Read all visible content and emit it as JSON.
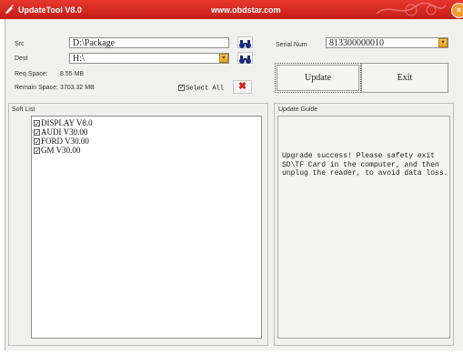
{
  "titlebar": {
    "title": "UpdateTool V8.0",
    "url": "www.obdstar.com",
    "close_glyph": "×",
    "app_icon": "red-tool-icon"
  },
  "form": {
    "src_label": "Src",
    "src_value": "D:\\Package",
    "dest_label": "Dest",
    "dest_value": "H:\\",
    "req_space_label": "Req Space:",
    "req_space_value": "8.55 MB",
    "remain_space_label": "Remain Space:",
    "remain_space_value": "3703.32 MB",
    "select_all_label": "Select All",
    "select_all_checked": true,
    "serial_num_label": "Serial Num",
    "serial_num_value": "813300000010"
  },
  "buttons": {
    "update": "Update",
    "exit": "Exit",
    "delete_glyph": "✖",
    "dropdown_glyph": "▼"
  },
  "soft_list": {
    "title": "Soft List",
    "check_glyph": "✓",
    "items": [
      {
        "label": "DISPLAY V8.0",
        "checked": true
      },
      {
        "label": "AUDI V30.00",
        "checked": true
      },
      {
        "label": "FORD V30.00",
        "checked": true
      },
      {
        "label": "GM V30.00",
        "checked": true
      }
    ]
  },
  "update_guide": {
    "title": "Update Guide",
    "message": "Upgrade success! Please safety exit SD\\TF Card in the computer, and then unplug the reader, to avoid data loss."
  },
  "colors": {
    "titlebar": "#d62a22",
    "accent": "#e3a51b",
    "delete": "#d2201b"
  }
}
